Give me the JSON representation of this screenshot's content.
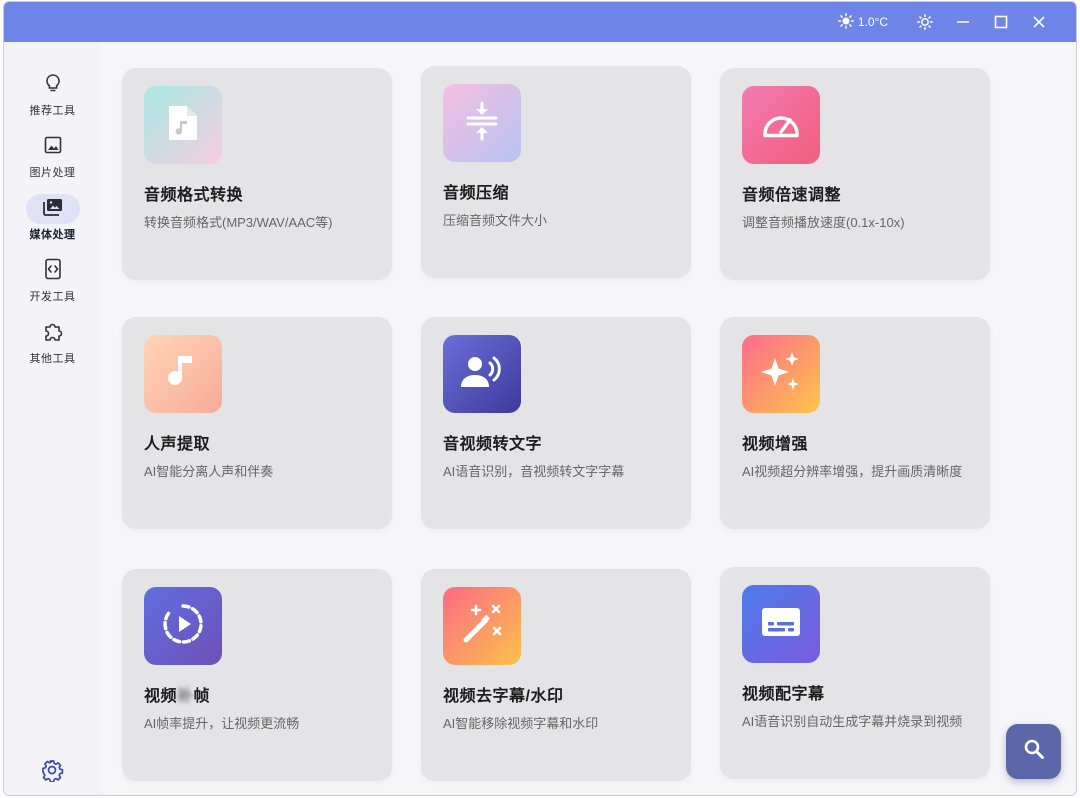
{
  "titlebar": {
    "temperature": "1.0°C",
    "icons": [
      "sun-icon",
      "brightness-icon",
      "minimize-icon",
      "maximize-icon",
      "close-icon"
    ]
  },
  "sidebar": {
    "items": [
      {
        "label": "推荐工具",
        "icon": "lightbulb-icon",
        "active": false
      },
      {
        "label": "图片处理",
        "icon": "image-icon",
        "active": false
      },
      {
        "label": "媒体处理",
        "icon": "media-library-icon",
        "active": true
      },
      {
        "label": "开发工具",
        "icon": "code-device-icon",
        "active": false
      },
      {
        "label": "其他工具",
        "icon": "puzzle-icon",
        "active": false
      }
    ],
    "settings_icon": "gear-icon"
  },
  "tools": [
    {
      "title": "音频格式转换",
      "desc": "转换音频格式(MP3/WAV/AAC等)",
      "icon": "audio-file-icon"
    },
    {
      "title": "音频压缩",
      "desc": "压缩音频文件大小",
      "icon": "compress-icon"
    },
    {
      "title": "音频倍速调整",
      "desc": "调整音频播放速度(0.1x-10x)",
      "icon": "speedometer-icon"
    },
    {
      "title": "人声提取",
      "desc": "AI智能分离人声和伴奏",
      "icon": "music-note-icon"
    },
    {
      "title": "音视频转文字",
      "desc": "AI语音识别，音视频转文字字幕",
      "icon": "voice-recognition-icon"
    },
    {
      "title": "视频增强",
      "desc": "AI视频超分辨率增强，提升画质清晰度",
      "icon": "sparkle-icon"
    },
    {
      "title_pre": "视频",
      "title_blur": "补",
      "title_post": "帧",
      "desc": "AI帧率提升，让视频更流畅",
      "icon": "play-circle-icon"
    },
    {
      "title": "视频去字幕/水印",
      "desc": "AI智能移除视频字幕和水印",
      "icon": "magic-wand-icon"
    },
    {
      "title": "视频配字幕",
      "desc": "AI语音识别自动生成字幕并烧录到视频",
      "icon": "subtitles-icon"
    }
  ],
  "colors": {
    "titlebar": "#6e84e6",
    "card": "#e4e4e6",
    "fab": "#5b67a8"
  },
  "fab": {
    "icon": "search-icon"
  }
}
